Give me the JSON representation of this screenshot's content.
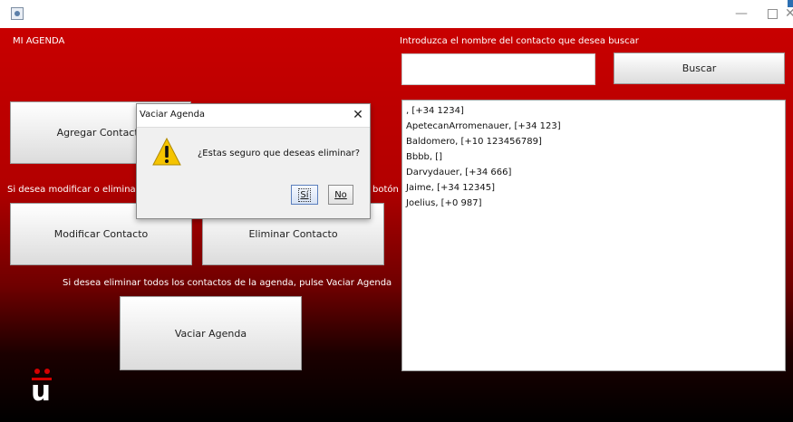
{
  "titlebar": {
    "window_controls": {
      "minimize": "—",
      "close": "✕"
    }
  },
  "main": {
    "header_label": "MI AGENDA",
    "search_prompt": "Introduzca el nombre del contacto que desea buscar",
    "search_value": "",
    "search_button": "Buscar",
    "add_button": "Agregar Contacto",
    "modify_hint_left": "Si desea modificar o eliminar",
    "modify_hint_right": "botón",
    "modify_button": "Modificar Contacto",
    "delete_button": "Eliminar Contacto",
    "empty_hint": "Si desea eliminar todos los contactos de la agenda, pulse Vaciar Agenda",
    "empty_button": "Vaciar Agenda",
    "contacts": [
      ", [+34 1234]",
      "ApetecanArromenauer, [+34 123]",
      "Baldomero, [+10 123456789]",
      "Bbbb, []",
      "Darvydauer, [+34 666]",
      "Jaime, [+34 12345]",
      "Joelius, [+0 987]"
    ]
  },
  "dialog": {
    "title": "Vaciar Agenda",
    "close": "✕",
    "message": "¿Estas seguro que deseas eliminar?",
    "yes_label": "Sí",
    "no_label": "No",
    "icon": "warning-icon"
  }
}
